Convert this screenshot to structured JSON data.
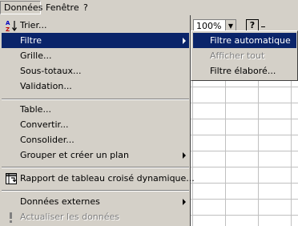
{
  "menubar": {
    "items": [
      "Données",
      "Fenêtre",
      "?"
    ]
  },
  "toolbar": {
    "zoom": "100%",
    "help_glyph": "?"
  },
  "menu": {
    "items": [
      {
        "label": "Trier...",
        "icon": "sort-az-icon"
      },
      {
        "label": "Filtre",
        "submenu": true,
        "highlighted": true
      },
      {
        "label": "Grille..."
      },
      {
        "label": "Sous-totaux..."
      },
      {
        "label": "Validation..."
      },
      {
        "label": "Table..."
      },
      {
        "label": "Convertir..."
      },
      {
        "label": "Consolider..."
      },
      {
        "label": "Grouper et créer un plan",
        "submenu": true
      },
      {
        "label": "Rapport de tableau croisé dynamique...",
        "icon": "pivot-table-icon"
      },
      {
        "label": "Données externes",
        "submenu": true
      },
      {
        "label": "Actualiser les données",
        "icon": "refresh-exclamation-icon",
        "disabled": true
      }
    ]
  },
  "submenu": {
    "items": [
      {
        "label": "Filtre automatique",
        "highlighted": true
      },
      {
        "label": "Afficher tout",
        "disabled": true
      },
      {
        "label": "Filtre élaboré..."
      }
    ]
  },
  "colors": {
    "face": "#d4d0c8",
    "highlight": "#0a246a",
    "disabled_text": "#808080"
  }
}
